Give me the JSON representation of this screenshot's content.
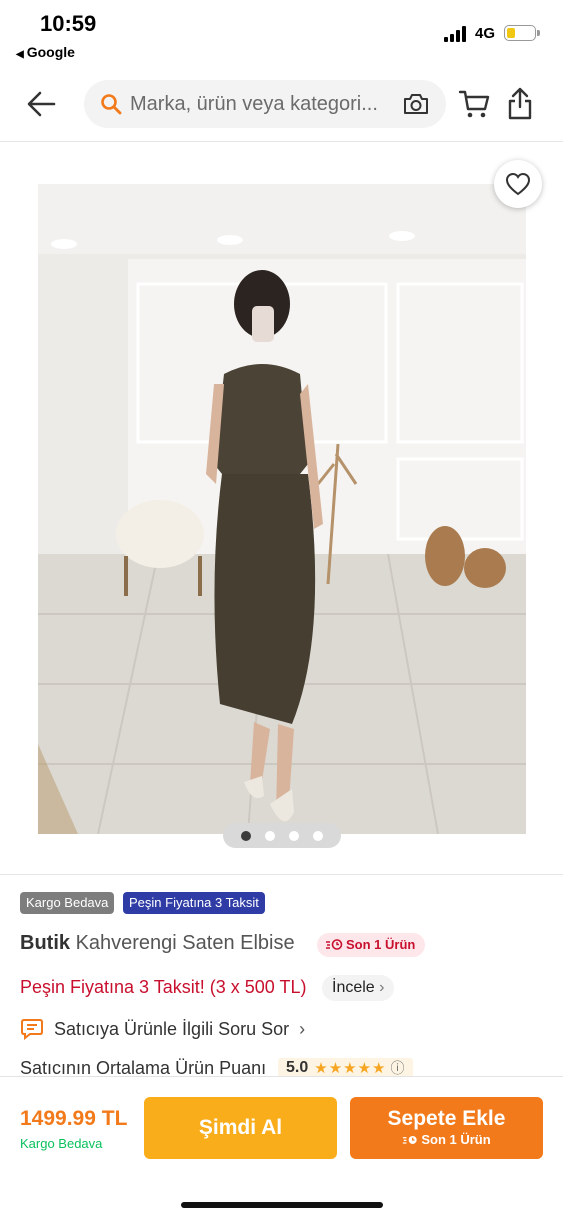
{
  "status_bar": {
    "time": "10:59",
    "back_app": "Google",
    "network": "4G",
    "battery_level": 0.3
  },
  "header": {
    "search_placeholder": "Marka, ürün veya kategori...",
    "icons": [
      "back-arrow-icon",
      "search-icon",
      "camera-icon",
      "cart-icon",
      "share-icon"
    ]
  },
  "gallery": {
    "image_count": 4,
    "active_index": 1,
    "favorite_icon": "heart-outline-icon"
  },
  "product": {
    "badges": [
      "Kargo Bedava",
      "Peşin Fiyatına 3 Taksit"
    ],
    "brand": "Butik",
    "name": "Kahverengi Saten Elbise",
    "stock_label": "Son 1 Ürün",
    "installment_text": "Peşin Fiyatına 3 Taksit! (3 x 500 TL)",
    "installment_link": "İncele",
    "seller_question": "Satıcıya Ürünle İlgili Soru Sor",
    "seller_rating_label": "Satıcının Ortalama Ürün Puanı",
    "seller_rating": "5.0",
    "seller_stars": 5
  },
  "bottom_bar": {
    "price": "1499.99 TL",
    "shipping": "Kargo Bedava",
    "buy_now": "Şimdi Al",
    "add_to_cart": "Sepete Ekle",
    "add_to_cart_sub": "Son 1 Ürün"
  },
  "colors": {
    "brand_orange": "#f27a1a",
    "buy_now_yellow": "#f9ad1b",
    "installment_red": "#c8102e",
    "badge_blue": "#2f3ca6",
    "badge_grey": "#7d7d7d",
    "shipping_green": "#0bc15c"
  }
}
